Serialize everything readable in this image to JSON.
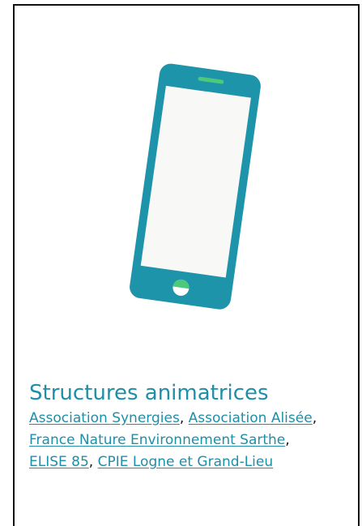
{
  "illustration": {
    "icon": "smartphone-icon",
    "colors": {
      "body": "#1e94ab",
      "screen": "#f8f8f6",
      "speaker": "#4cc97a",
      "home_button": "#4cc97a"
    }
  },
  "section": {
    "title": "Structures animatrices",
    "links": [
      "Association Synergies",
      "Association Alisée",
      "France Nature Environnement Sarthe",
      "ELISE 85",
      "CPIE Logne et Grand-Lieu"
    ],
    "separator": ", "
  },
  "colors": {
    "accent": "#1e8fa8",
    "border": "#111111",
    "text": "#111111"
  }
}
